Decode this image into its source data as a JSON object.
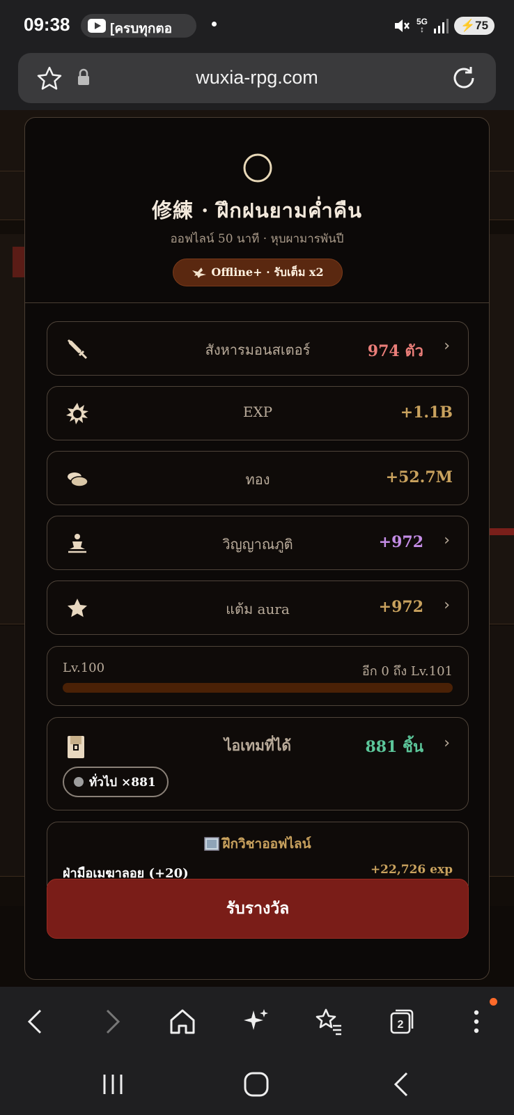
{
  "status_bar": {
    "time": "09:38",
    "notification_text": "[ครบทุกตอ",
    "network": "5G",
    "battery": "75"
  },
  "browser": {
    "url": "wuxia-rpg.com",
    "tab_count": "2"
  },
  "modal": {
    "title": "修練 · ฝึกฝนยามค่ำคืน",
    "subtitle": "ออฟไลน์ 50 นาที · หุบผามารพันปี",
    "badge": "Offline+ · รับเต็ม x2",
    "rows": [
      {
        "label": "สังหารมอนสเตอร์",
        "value": "974 ตัว",
        "icon": "dagger-icon",
        "color": "#ea7e79"
      },
      {
        "label": "EXP",
        "value": "+1.1B",
        "icon": "burst-icon",
        "color": "#c9a25e"
      },
      {
        "label": "ทอง",
        "value": "+52.7M",
        "icon": "coins-icon",
        "color": "#c9a25e"
      },
      {
        "label": "วิญญาณภูติ",
        "value": "+972",
        "icon": "meditate-icon",
        "color": "#c48de6"
      },
      {
        "label": "แต้ม aura",
        "value": "+972",
        "icon": "star-icon",
        "color": "#c9a25e"
      }
    ],
    "level": {
      "current": "Lv.100",
      "next": "อีก 0 ถึง Lv.101",
      "progress": 0
    },
    "items": {
      "label": "ไอเทมที่ได้",
      "value": "881 ชิ้น",
      "chip": "ทั่วไป ×881"
    },
    "skill": {
      "header": "ฝึกวิชาออฟไลน์",
      "name": "ฝ่ามือเมฆาลอย (+20)",
      "exp": "+22,726 exp"
    },
    "claim_label": "รับรางวัล"
  }
}
